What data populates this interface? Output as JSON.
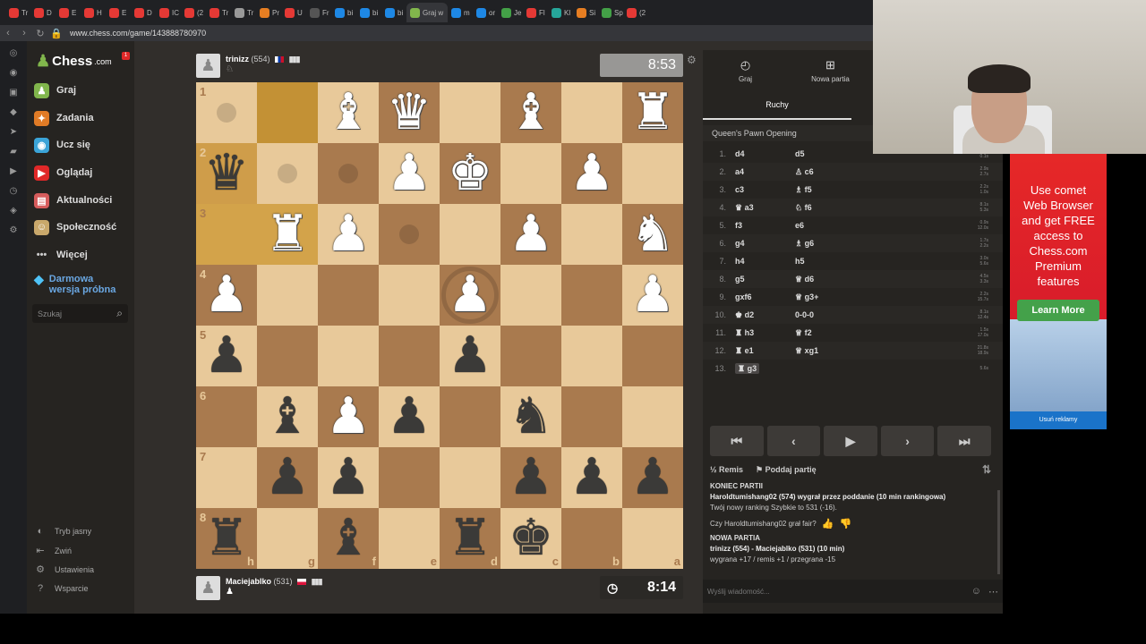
{
  "browser": {
    "tabs": [
      "Tr",
      "D",
      "E",
      "H",
      "E",
      "D",
      "IC",
      "(2",
      "Tr",
      "Tr",
      "Pr",
      "U",
      "Fr",
      "bi",
      "bi",
      "bi",
      "Graj w",
      "m",
      "or",
      "Je",
      "Fl",
      "Kl",
      "Si",
      "Sp",
      "(2"
    ],
    "active_tab": "Graj w",
    "url": "www.chess.com/game/143888780970"
  },
  "sidebar": {
    "logo": "Chess",
    "logo_suffix": ".com",
    "notification": "1",
    "nav": [
      {
        "label": "Graj",
        "icon": "play-icon",
        "color": "#81b64c"
      },
      {
        "label": "Zadania",
        "icon": "puzzle-icon",
        "color": "#e07b26"
      },
      {
        "label": "Ucz się",
        "icon": "learn-icon",
        "color": "#3ba4d8"
      },
      {
        "label": "Oglądaj",
        "icon": "watch-icon",
        "color": "#e02828"
      },
      {
        "label": "Aktualności",
        "icon": "news-icon",
        "color": "#d65c5c"
      },
      {
        "label": "Społeczność",
        "icon": "community-icon",
        "color": "#c9a86b"
      },
      {
        "label": "Więcej",
        "icon": "more-icon",
        "color": "#999999"
      }
    ],
    "trial_line1": "Darmowa",
    "trial_line2": "wersja próbna",
    "search_placeholder": "Szukaj",
    "bottom": [
      "Tryb jasny",
      "Zwiń",
      "Ustawienia",
      "Wsparcie"
    ]
  },
  "top_player": {
    "name": "trinizz",
    "rating": "(554)",
    "clock": "8:53"
  },
  "bottom_player": {
    "name": "Maciejablko",
    "rating": "(531)",
    "clock": "8:14"
  },
  "board": {
    "ranks": [
      "1",
      "2",
      "3",
      "4",
      "5",
      "6",
      "7",
      "8"
    ],
    "files": [
      "h",
      "g",
      "f",
      "e",
      "d",
      "c",
      "b",
      "a"
    ],
    "rows": [
      [
        "",
        "",
        "wB",
        "wQ",
        "",
        "wB",
        "",
        "wR"
      ],
      [
        "bQ",
        "",
        "",
        "wP",
        "wK",
        "",
        "wP",
        ""
      ],
      [
        "",
        "wR",
        "wP",
        "",
        "",
        "wP",
        "",
        "wN"
      ],
      [
        "wP",
        "",
        "",
        "",
        "wP",
        "",
        "",
        "wP"
      ],
      [
        "bP",
        "",
        "",
        "",
        "bP",
        "",
        "",
        ""
      ],
      [
        "",
        "bB",
        "wP",
        "bP",
        "",
        "bN",
        "",
        ""
      ],
      [
        "",
        "bP",
        "bP",
        "",
        "",
        "bP",
        "bP",
        "bP"
      ],
      [
        "bR",
        "",
        "bB",
        "",
        "bR",
        "bK",
        "",
        ""
      ]
    ]
  },
  "panel": {
    "tab_play": "Graj",
    "tab_new": "Nowa partia",
    "subtab": "Ruchy",
    "opening": "Queen's Pawn Opening",
    "moves": [
      {
        "n": "1.",
        "w": "d4",
        "b": "d5"
      },
      {
        "n": "2.",
        "w": "a4",
        "b": "♙ c6"
      },
      {
        "n": "3.",
        "w": "c3",
        "b": "♗ f5"
      },
      {
        "n": "4.",
        "w": "♛ a3",
        "b": "♘ f6"
      },
      {
        "n": "5.",
        "w": "f3",
        "b": "e6"
      },
      {
        "n": "6.",
        "w": "g4",
        "b": "♗ g6"
      },
      {
        "n": "7.",
        "w": "h4",
        "b": "h5"
      },
      {
        "n": "8.",
        "w": "g5",
        "b": "♕ d6"
      },
      {
        "n": "9.",
        "w": "gxf6",
        "b": "♕ g3+"
      },
      {
        "n": "10.",
        "w": "♚ d2",
        "b": "0-0-0"
      },
      {
        "n": "11.",
        "w": "♜ h3",
        "b": "♕ f2"
      },
      {
        "n": "12.",
        "w": "♜ e1",
        "b": "♕ xg1"
      },
      {
        "n": "13.",
        "w": "♜ g3",
        "b": ""
      }
    ],
    "move_times": [
      [
        "1.2s",
        "0.1s"
      ],
      [
        "2.9s",
        "2.7s"
      ],
      [
        "2.2s",
        "1.0s"
      ],
      [
        "8.1s",
        "5.3s"
      ],
      [
        "0.9s",
        "12.0s"
      ],
      [
        "1.7s",
        "2.2s"
      ],
      [
        "3.0s",
        "5.6s"
      ],
      [
        "4.5s",
        "3.3s"
      ],
      [
        "2.2s",
        "15.7s"
      ],
      [
        "8.1s",
        "12.4s"
      ],
      [
        "1.5s",
        "17.0s"
      ],
      [
        "21.8s",
        "18.9s"
      ],
      [
        "5.6s",
        ""
      ]
    ],
    "remis": "Remis",
    "resign": "Podda­j partię",
    "chat": {
      "line1": "KONIEC PARTII",
      "line2": "Haroldtumishang02 (574) wygrał przez poddanie (10 min rankingowa)",
      "line3": "Twój nowy ranking Szybkie to 531 (-16).",
      "line4": "Czy Haroldtumishang02 grał fair?",
      "line5": "NOWA PARTIA",
      "line6": "trinizz (554) - Maciejablko (531) (10 min)",
      "line7": "wygrana +17 / remis +1 / przegrana -15"
    },
    "chat_placeholder": "Wyślij wiadomość..."
  },
  "ad": {
    "lines": [
      "Use comet",
      "Web Browser",
      "and get FREE",
      "access to",
      "Chess.com",
      "Premium",
      "features"
    ],
    "button": "Learn More",
    "close": "Usuń reklamy"
  },
  "colors": {
    "accent": "#81b64c",
    "board_light": "#e8c99a",
    "board_dark": "#a97a4e",
    "highlight": "#d3a34a"
  }
}
